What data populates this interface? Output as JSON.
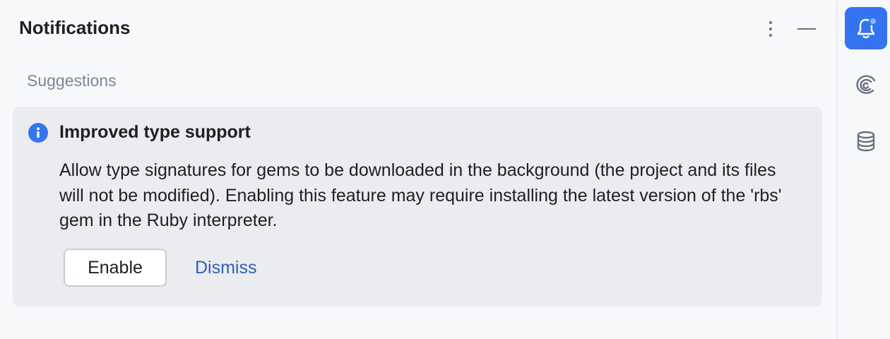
{
  "header": {
    "title": "Notifications",
    "more_icon": "more-vertical-icon",
    "minimize_icon": "minimize-icon"
  },
  "section": {
    "title": "Suggestions"
  },
  "notification": {
    "icon": "info-icon",
    "title": "Improved type support",
    "body": "Allow type signatures for gems to be downloaded in the background (the project and its files will not be modified). Enabling this feature may require installing the latest version of the 'rbs' gem in the Ruby interpreter.",
    "primary_action": "Enable",
    "secondary_action": "Dismiss"
  },
  "sidebar": {
    "items": [
      {
        "icon": "bell-icon",
        "active": true,
        "has_badge": true
      },
      {
        "icon": "swirl-icon",
        "active": false
      },
      {
        "icon": "database-icon",
        "active": false
      }
    ]
  },
  "colors": {
    "accent": "#3574f0",
    "link": "#2f5fb3",
    "card_background": "#ebecf0",
    "panel_background": "#f7f8fa"
  }
}
